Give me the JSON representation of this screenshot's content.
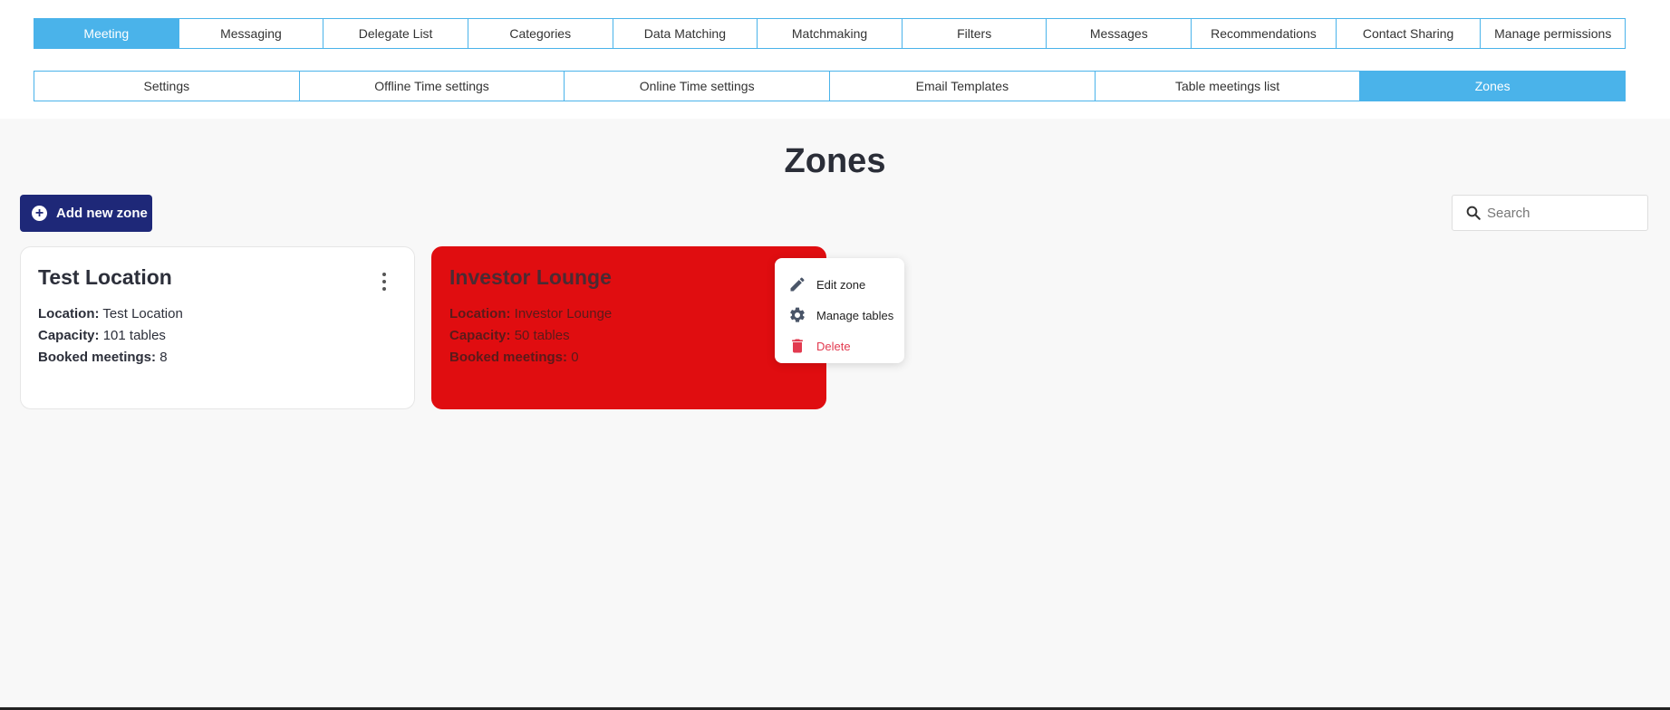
{
  "nav": {
    "primary_tabs": [
      {
        "label": "Meeting",
        "active": true
      },
      {
        "label": "Messaging"
      },
      {
        "label": "Delegate List"
      },
      {
        "label": "Categories"
      },
      {
        "label": "Data Matching"
      },
      {
        "label": "Matchmaking"
      },
      {
        "label": "Filters"
      },
      {
        "label": "Messages"
      },
      {
        "label": "Recommendations"
      },
      {
        "label": "Contact Sharing"
      },
      {
        "label": "Manage permissions"
      }
    ],
    "secondary_tabs": [
      {
        "label": "Settings"
      },
      {
        "label": "Offline Time settings"
      },
      {
        "label": "Online Time settings"
      },
      {
        "label": "Email Templates"
      },
      {
        "label": "Table meetings list"
      },
      {
        "label": "Zones",
        "active": true
      }
    ]
  },
  "page": {
    "title": "Zones",
    "add_button_label": "Add new zone",
    "search_placeholder": "Search"
  },
  "zones": [
    {
      "name": "Test Location",
      "location_label": "Location:",
      "location": "Test Location",
      "capacity_label": "Capacity:",
      "capacity": "101 tables",
      "booked_label": "Booked meetings:",
      "booked": "8"
    },
    {
      "name": "Investor Lounge",
      "location_label": "Location:",
      "location": "Investor Lounge",
      "capacity_label": "Capacity:",
      "capacity": "50 tables",
      "booked_label": "Booked meetings:",
      "booked": "0"
    }
  ],
  "context_menu": {
    "items": [
      {
        "label": "Edit zone",
        "icon": "pencil-icon"
      },
      {
        "label": "Manage tables",
        "icon": "gear-icon"
      },
      {
        "label": "Delete",
        "icon": "trash-icon"
      }
    ]
  },
  "colors": {
    "accent": "#4ab3ea",
    "primary_button": "#1e2878",
    "highlight_card": "#e00d10",
    "danger": "#e23a4f"
  }
}
